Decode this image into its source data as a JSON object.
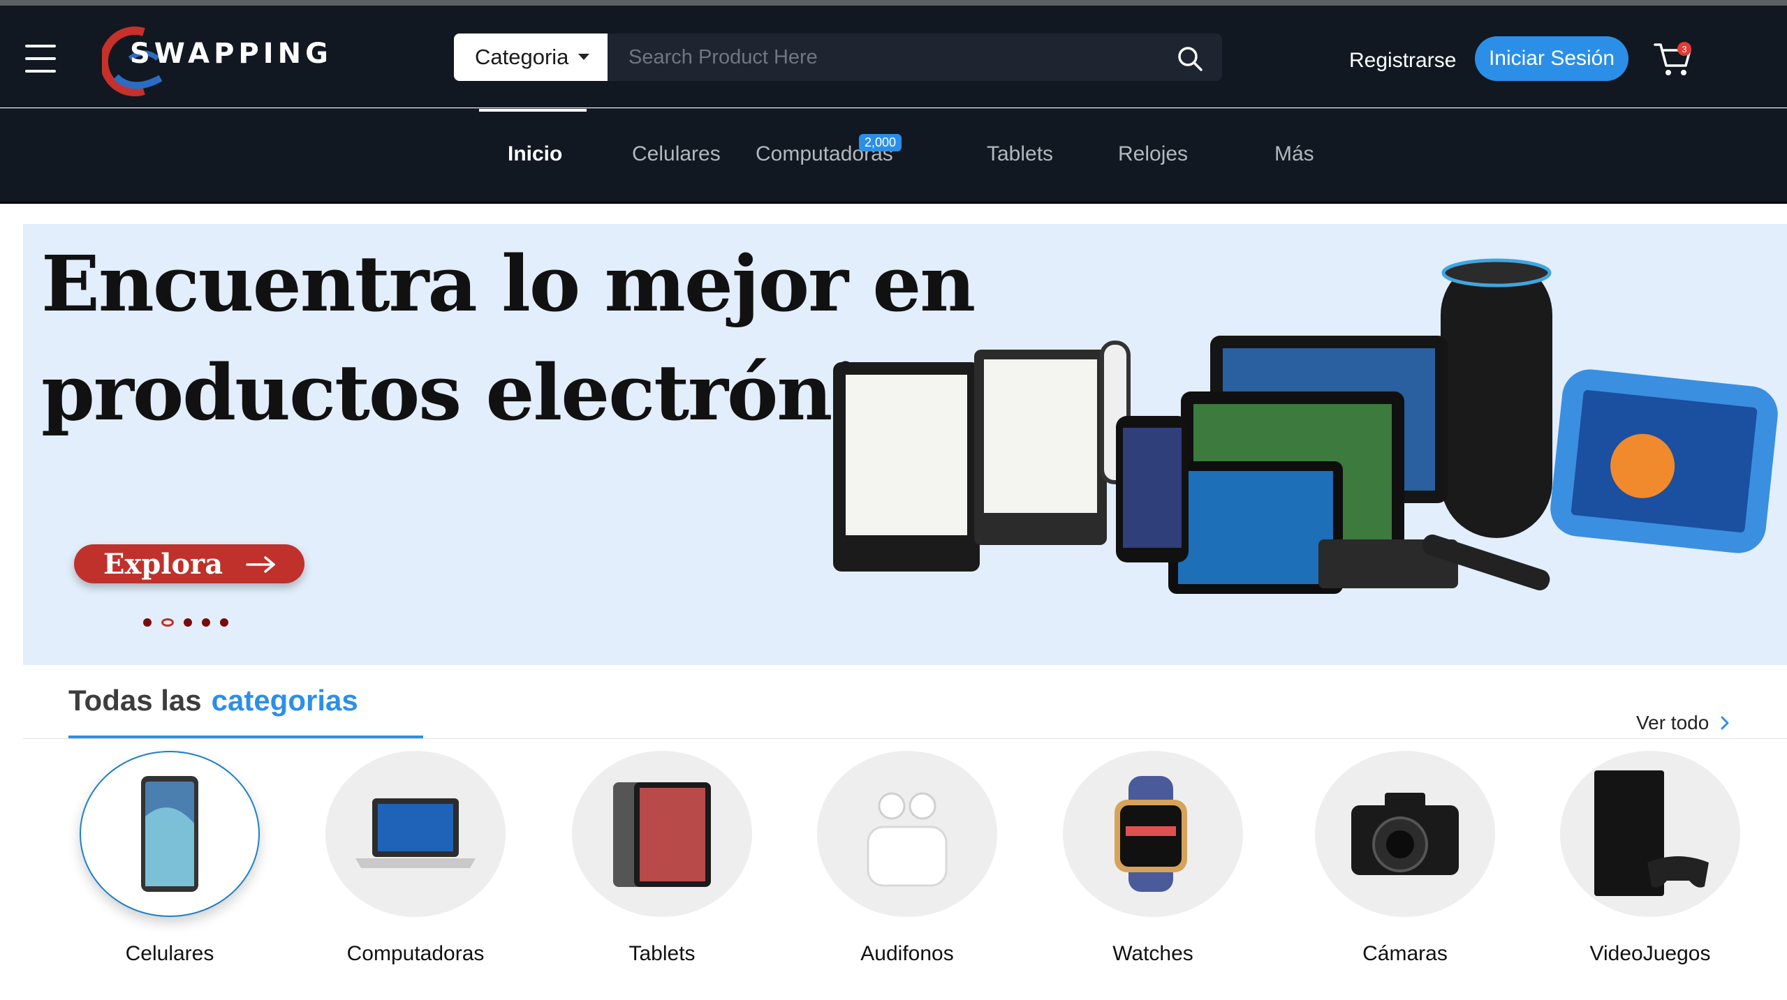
{
  "header": {
    "logo_text": "SWAPPING",
    "category_select": "Categoria",
    "search_placeholder": "Search Product Here",
    "register_label": "Registrarse",
    "login_label": "Iniciar Sesión",
    "cart_count": "3"
  },
  "nav": {
    "items": [
      {
        "label": "Inicio"
      },
      {
        "label": "Celulares"
      },
      {
        "label": "Computadoras"
      },
      {
        "label": "Tablets"
      },
      {
        "label": "Relojes"
      },
      {
        "label": "Más"
      }
    ],
    "badge": "2,000"
  },
  "hero": {
    "title_line1": "Encuentra lo mejor en",
    "title_line2": "productos electrónicos",
    "explore_label": "Explora",
    "slide_count": 5,
    "active_slide": 2
  },
  "categories": {
    "heading_prefix": "Todas las",
    "heading_accent": "categorias",
    "see_all": "Ver todo",
    "items": [
      {
        "label": "Celulares"
      },
      {
        "label": "Computadoras"
      },
      {
        "label": "Tablets"
      },
      {
        "label": "Audifonos"
      },
      {
        "label": "Watches"
      },
      {
        "label": "Cámaras"
      },
      {
        "label": "VideoJuegos"
      }
    ]
  },
  "colors": {
    "header_bg": "#111821",
    "accent_blue": "#2b8fe8",
    "hero_bg": "#e2eefb",
    "explore_red": "#c0312b"
  }
}
